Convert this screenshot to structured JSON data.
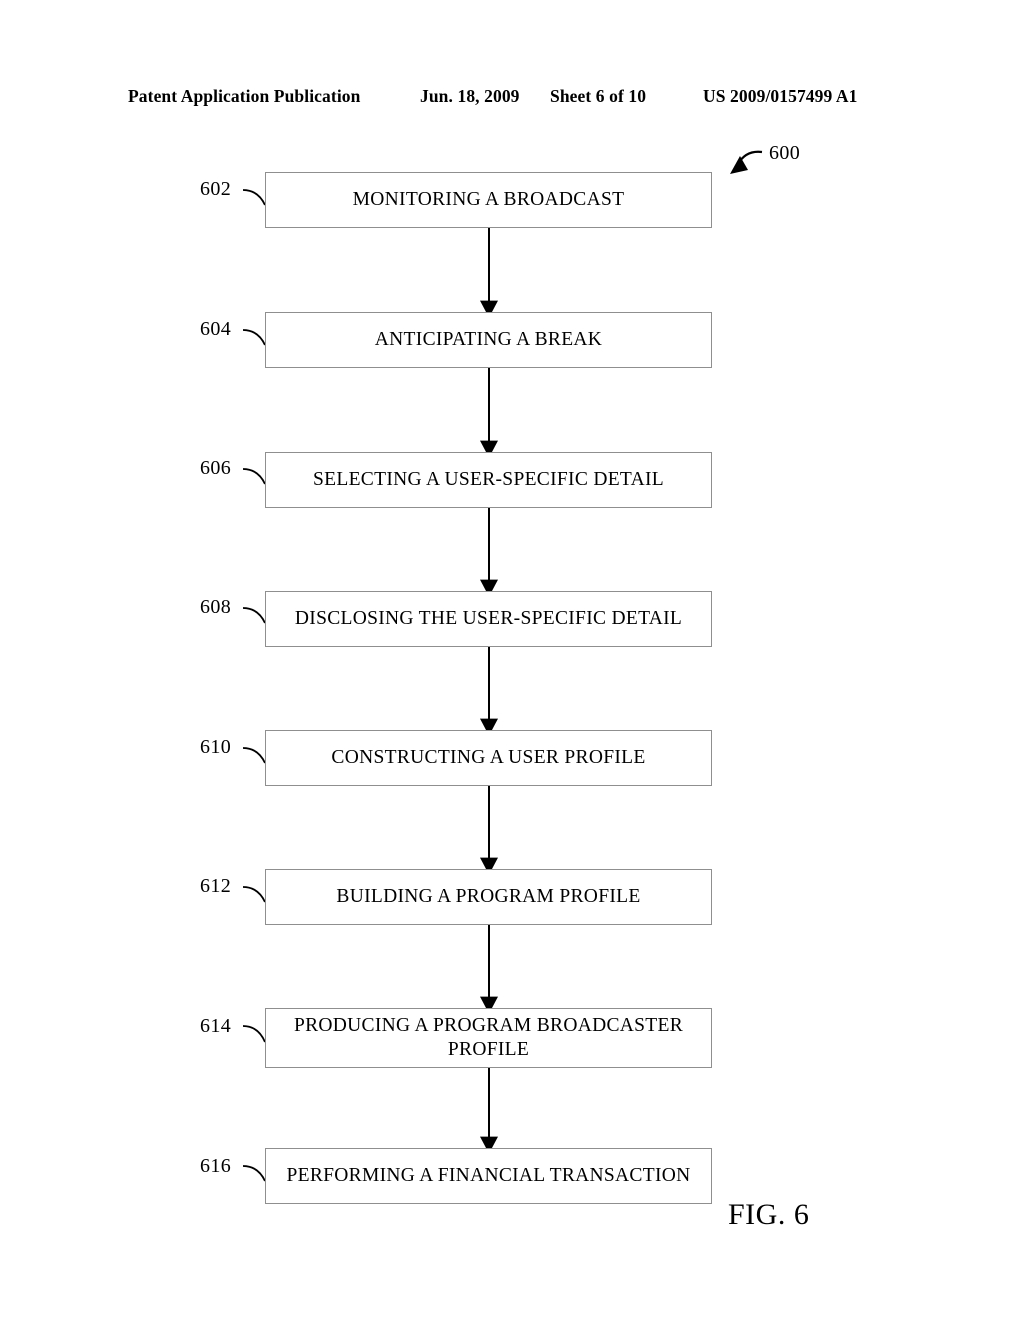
{
  "header": {
    "publication": "Patent Application Publication",
    "date": "Jun. 18, 2009",
    "sheet": "Sheet 6 of 10",
    "patent_number": "US 2009/0157499 A1"
  },
  "figure": {
    "caption": "FIG. 6",
    "diagram_reference": "600",
    "type": "flowchart",
    "orientation": "vertical top-to-bottom",
    "colors": {
      "box_border": "#8f8f8f",
      "connector": "#000000",
      "text": "#000000",
      "background": "#ffffff"
    },
    "steps": [
      {
        "ref": "602",
        "label": "MONITORING A BROADCAST"
      },
      {
        "ref": "604",
        "label": "ANTICIPATING A BREAK"
      },
      {
        "ref": "606",
        "label": "SELECTING A USER-SPECIFIC DETAIL"
      },
      {
        "ref": "608",
        "label": "DISCLOSING THE USER-SPECIFIC DETAIL"
      },
      {
        "ref": "610",
        "label": "CONSTRUCTING A USER PROFILE"
      },
      {
        "ref": "612",
        "label": "BUILDING A PROGRAM PROFILE"
      },
      {
        "ref": "614",
        "label": "PRODUCING A PROGRAM BROADCASTER\nPROFILE"
      },
      {
        "ref": "616",
        "label": "PERFORMING A FINANCIAL TRANSACTION"
      }
    ]
  }
}
